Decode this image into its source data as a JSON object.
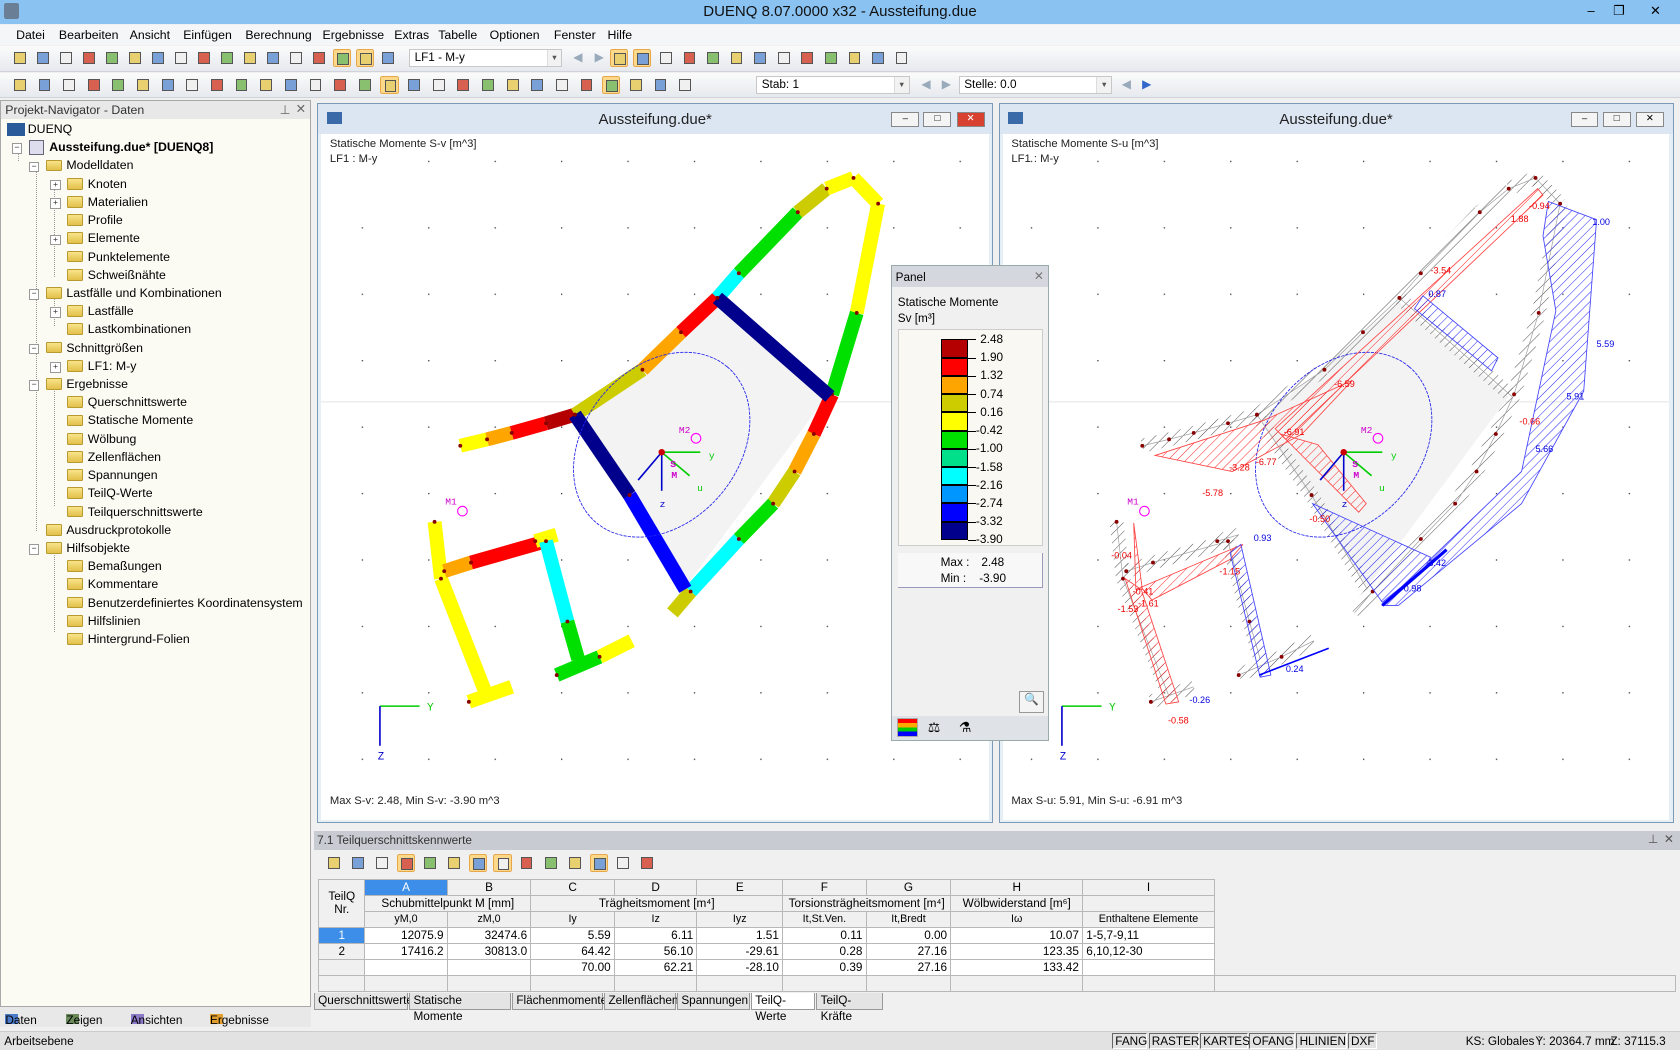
{
  "window": {
    "title": "DUENQ 8.07.0000 x32 - Aussteifung.due",
    "min": "–",
    "max": "❐",
    "close": "✕"
  },
  "menu": [
    "Datei",
    "Bearbeiten",
    "Ansicht",
    "Einfügen",
    "Berechnung",
    "Ergebnisse",
    "Extras",
    "Tabelle",
    "Optionen",
    "Fenster",
    "Hilfe"
  ],
  "toolbar1": {
    "icons": [
      "new-icon",
      "open-icon",
      "archive-icon",
      "save-icon",
      "print-report-icon",
      "print-icon",
      "print-preview-icon",
      "undo-icon",
      "redo-icon",
      "edit-icon",
      "render-icon",
      "target-icon",
      "comment-icon",
      "window-icon",
      "table-icon",
      "table2-icon",
      "load-icon"
    ],
    "loadcase": "LF1 - M-y",
    "right_icons": [
      "results-icon",
      "values-icon",
      "deform-icon",
      "calc-icon",
      "calc2-icon",
      "grid-icon",
      "snap-icon",
      "node-icon",
      "section-icon",
      "axis-icon",
      "delete-icon",
      "info-icon",
      "settings-icon"
    ]
  },
  "toolbar2": {
    "icons": [
      "point-icon",
      "line-icon",
      "arc-icon",
      "element-icon",
      "weld-icon",
      "profile-icon",
      "dimension-icon",
      "dim2-icon",
      "frame-icon",
      "model-icon",
      "zoom-icon",
      "zoom-x-icon",
      "colors-icon",
      "section-icon",
      "Qu-icon",
      "Qv-icon",
      "omega-icon",
      "Qomega-icon",
      "sigma-x-icon",
      "tau-icon",
      "sigma-v-icon",
      "percent-icon",
      "sigma-pl-icon",
      "pen-icon",
      "target-icon",
      "list-icon",
      "bracket-icon",
      "color-scale-icon"
    ],
    "member_label": "Stab: 1",
    "location_label": "Stelle: 0.0"
  },
  "navigator": {
    "title": "Projekt-Navigator - Daten",
    "tree": [
      {
        "label": "DUENQ",
        "level": 0
      },
      {
        "label": "Aussteifung.due* [DUENQ8]",
        "level": 0,
        "bold": true,
        "expander": "−"
      },
      {
        "label": "Modelldaten",
        "level": 1,
        "expander": "−"
      },
      {
        "label": "Knoten",
        "level": 2,
        "expander": "+"
      },
      {
        "label": "Materialien",
        "level": 2,
        "expander": "+"
      },
      {
        "label": "Profile",
        "level": 2
      },
      {
        "label": "Elemente",
        "level": 2,
        "expander": "+"
      },
      {
        "label": "Punktelemente",
        "level": 2
      },
      {
        "label": "Schweißnähte",
        "level": 2
      },
      {
        "label": "Lastfälle und Kombinationen",
        "level": 1,
        "expander": "−"
      },
      {
        "label": "Lastfälle",
        "level": 2,
        "expander": "+"
      },
      {
        "label": "Lastkombinationen",
        "level": 2
      },
      {
        "label": "Schnittgrößen",
        "level": 1,
        "expander": "−"
      },
      {
        "label": "LF1: M-y",
        "level": 2,
        "expander": "+"
      },
      {
        "label": "Ergebnisse",
        "level": 1,
        "expander": "−"
      },
      {
        "label": "Querschnittswerte",
        "level": 2
      },
      {
        "label": "Statische Momente",
        "level": 2
      },
      {
        "label": "Wölbung",
        "level": 2
      },
      {
        "label": "Zellenflächen",
        "level": 2
      },
      {
        "label": "Spannungen",
        "level": 2
      },
      {
        "label": "TeilQ-Werte",
        "level": 2
      },
      {
        "label": "Teilquerschnittswerte",
        "level": 2
      },
      {
        "label": "Ausdruckprotokolle",
        "level": 1
      },
      {
        "label": "Hilfsobjekte",
        "level": 1,
        "expander": "−"
      },
      {
        "label": "Bemaßungen",
        "level": 2
      },
      {
        "label": "Kommentare",
        "level": 2
      },
      {
        "label": "Benutzerdefiniertes Koordinatensystem",
        "level": 2
      },
      {
        "label": "Hilfslinien",
        "level": 2
      },
      {
        "label": "Hintergrund-Folien",
        "level": 2
      }
    ],
    "tabs": [
      "Daten",
      "Zeigen",
      "Ansichten",
      "Ergebnisse"
    ]
  },
  "views": [
    {
      "title": "Aussteifung.due*",
      "line1": "Statische Momente S-v [m^3]",
      "line2": "LF1 : M-y",
      "footer": "Max S-v: 2.48, Min S-v: -3.90 m^3",
      "axes": {
        "y": "Y",
        "z": "Z",
        "local_y": "y",
        "local_z": "z",
        "u": "u",
        "shear_center": "M",
        "centroid": "S",
        "m1": "M1",
        "m2": "M2"
      }
    },
    {
      "title": "Aussteifung.due*",
      "line1": "Statische Momente S-u [m^3]",
      "line2": "LF1 : M-y",
      "footer": "Max S-u: 5.91, Min S-u: -6.91 m^3",
      "axes": {
        "y": "Y",
        "z": "Z",
        "local_y": "y",
        "local_z": "z",
        "u": "u",
        "shear_center": "M",
        "centroid": "S",
        "m1": "M1",
        "m2": "M2"
      },
      "value_labels": [
        "1.88",
        "-0.94",
        "1.00",
        "-3.54",
        "0.87",
        "5.59",
        "-6.59",
        "5.91",
        "-0.66",
        "-6.91",
        "-6.77",
        "-3.28",
        "-5.78",
        "-0.50",
        "5.66",
        "0.93",
        "-1.15",
        "-0.04",
        "-0.41",
        "-1.61",
        "-1.53",
        "3.42",
        "0.98",
        "0.24",
        "-0.26",
        "-0.58"
      ]
    }
  ],
  "panel": {
    "title": "Panel",
    "heading": "Statische Momente",
    "unit": "Sv [m³]",
    "legend_values": [
      "2.48",
      "1.90",
      "1.32",
      "0.74",
      "0.16",
      "-0.42",
      "-1.00",
      "-1.58",
      "-2.16",
      "-2.74",
      "-3.32",
      "-3.90"
    ],
    "legend_colors": [
      "#b40000",
      "#ff0000",
      "#ffa500",
      "#cccc00",
      "#ffff00",
      "#00e000",
      "#00e08a",
      "#00ffff",
      "#0096ff",
      "#0000ff",
      "#00008c"
    ],
    "max_label": "Max  :",
    "max": "2.48",
    "min_label": "Min   :",
    "min": "-3.90"
  },
  "table": {
    "title": "7.1 Teilquerschnittskennwerte",
    "col_letters": [
      "A",
      "B",
      "C",
      "D",
      "E",
      "F",
      "G",
      "H",
      "I"
    ],
    "row_header": [
      "TeilQ",
      "Nr."
    ],
    "groups": [
      "Schubmittelpunkt M [mm]",
      "Trägheitsmoment [m⁴]",
      "Torsionsträgheitsmoment [m⁴]",
      "Wölbwiderstand [m⁶]"
    ],
    "subheaders": [
      "yM,0",
      "zM,0",
      "Iy",
      "Iz",
      "Iyz",
      "It,St.Ven.",
      "It,Bredt",
      "Iω",
      "Enthaltene Elemente"
    ],
    "rows": [
      {
        "nr": "1",
        "cells": [
          "12075.9",
          "32474.6",
          "5.59",
          "6.11",
          "1.51",
          "0.11",
          "0.00",
          "10.07",
          "1-5,7-9,11"
        ]
      },
      {
        "nr": "2",
        "cells": [
          "17416.2",
          "30813.0",
          "64.42",
          "56.10",
          "-29.61",
          "0.28",
          "27.16",
          "123.35",
          "6,10,12-30"
        ]
      },
      {
        "nr": "",
        "cells": [
          "",
          "",
          "70.00",
          "62.21",
          "-28.10",
          "0.39",
          "27.16",
          "133.42",
          ""
        ]
      }
    ],
    "tabs": [
      "Querschnittswerte",
      "Statische Momente",
      "Flächenmomente",
      "Zellenflächen",
      "Spannungen",
      "TeilQ-Werte",
      "TeilQ-Kräfte"
    ],
    "active_tab": "TeilQ-Werte"
  },
  "status": {
    "left": "Arbeitsebene",
    "toggles": [
      "FANG",
      "RASTER",
      "KARTES",
      "OFANG",
      "HLINIEN",
      "DXF"
    ],
    "cs": "KS: Globales `",
    "y": "Y:  20364.7 mm",
    "z": "Z:  37115.3 mm"
  }
}
